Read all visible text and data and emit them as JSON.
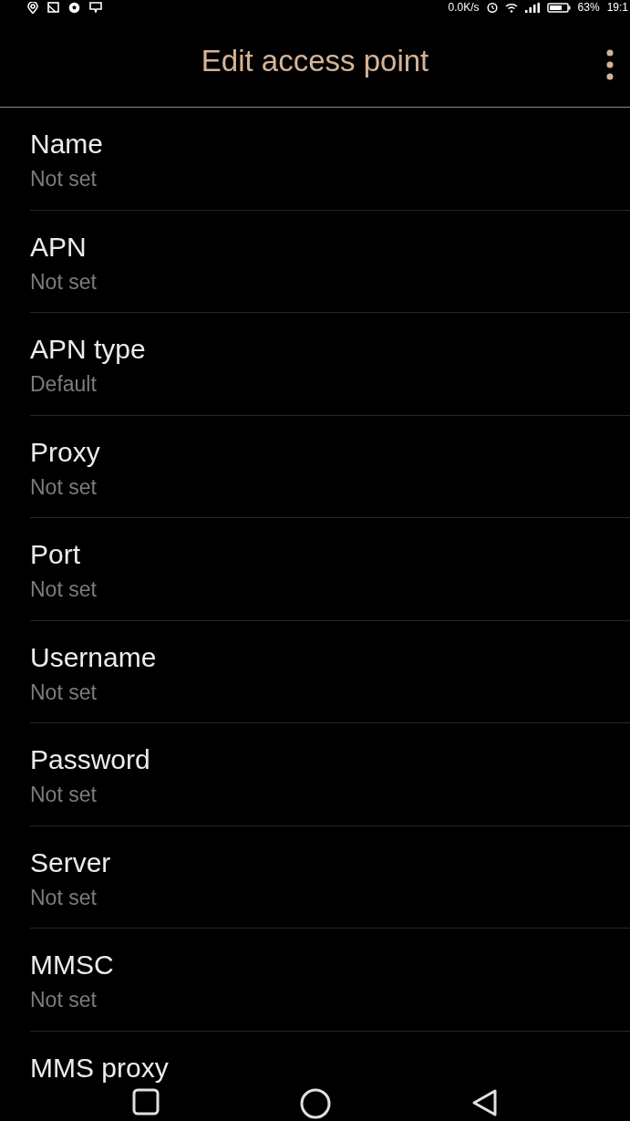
{
  "status_bar": {
    "network_speed": "0.0K/s",
    "battery": "63%",
    "time": "19:1"
  },
  "app_bar": {
    "title": "Edit access point"
  },
  "settings": [
    {
      "label": "Name",
      "summary": "Not set"
    },
    {
      "label": "APN",
      "summary": "Not set"
    },
    {
      "label": "APN type",
      "summary": "Default"
    },
    {
      "label": "Proxy",
      "summary": "Not set"
    },
    {
      "label": "Port",
      "summary": "Not set"
    },
    {
      "label": "Username",
      "summary": "Not set"
    },
    {
      "label": "Password",
      "summary": "Not set"
    },
    {
      "label": "Server",
      "summary": "Not set"
    },
    {
      "label": "MMSC",
      "summary": "Not set"
    },
    {
      "label": "MMS proxy"
    }
  ]
}
